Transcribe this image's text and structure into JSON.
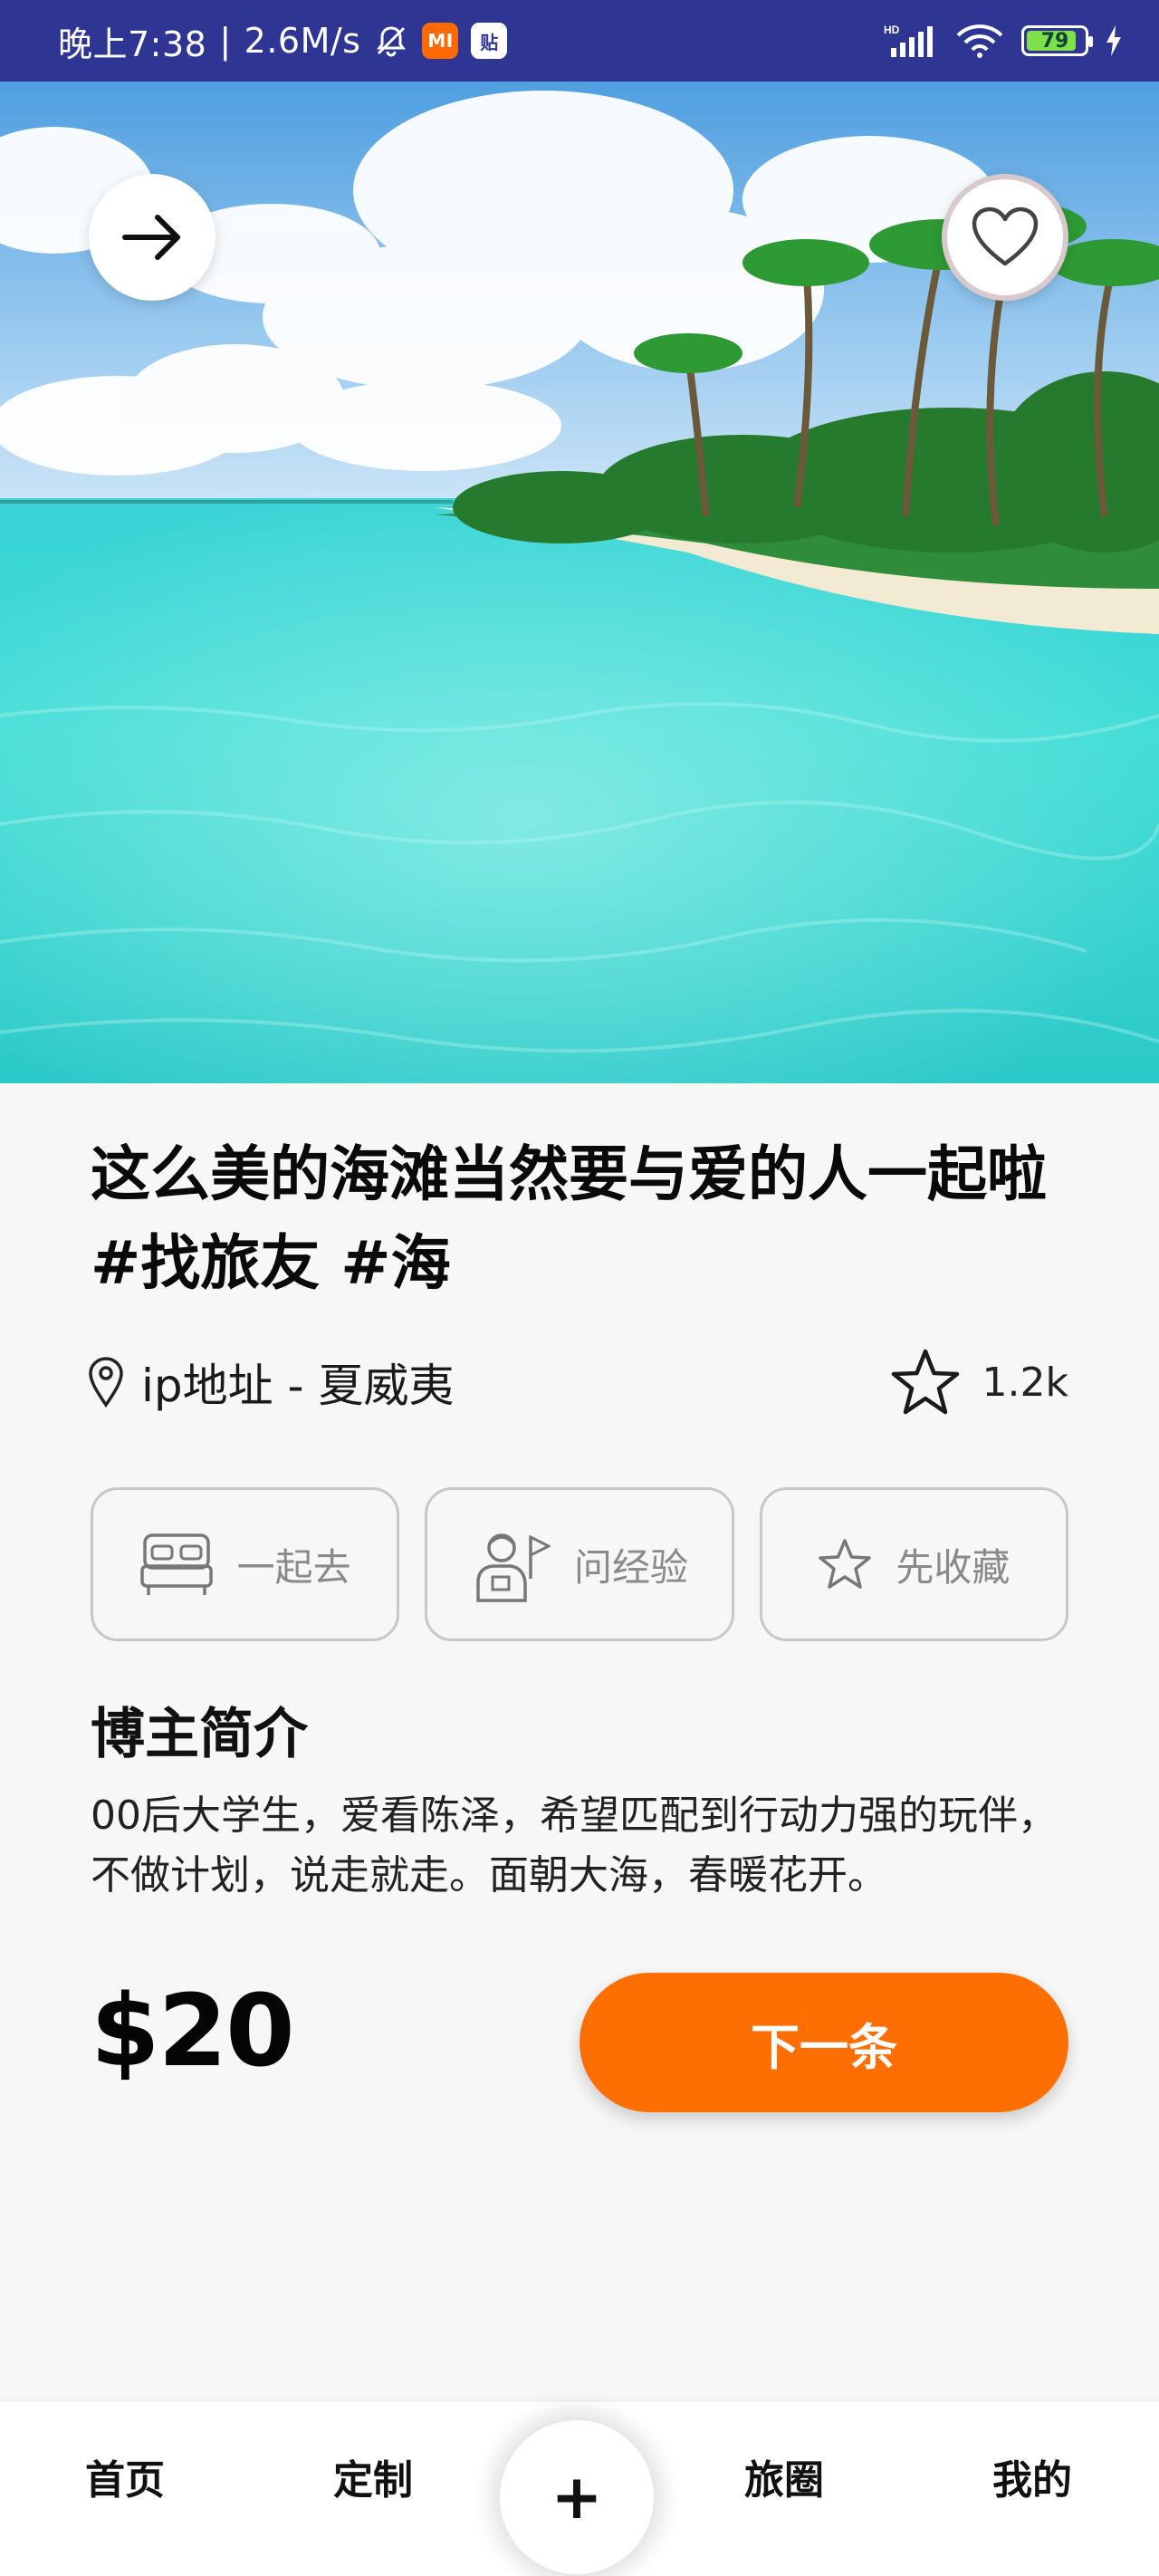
{
  "status_bar": {
    "time": "晚上7:38",
    "separator": "|",
    "speed": "2.6M/s",
    "mute_icon": "bell-off-icon",
    "app_icon_1": "MI",
    "app_icon_2": "贴",
    "network_label": "HD",
    "battery": "79",
    "battery_level": 0.79
  },
  "hero": {
    "next_icon": "arrow-right-icon",
    "like_icon": "heart-icon"
  },
  "post": {
    "title": "这么美的海滩当然要与爱的人一起啦 #找旅友 #海",
    "location": "ip地址 - 夏威夷",
    "star_count": "1.2k"
  },
  "actions": [
    {
      "label": "一起去",
      "icon": "bed-icon"
    },
    {
      "label": "问经验",
      "icon": "guide-icon"
    },
    {
      "label": "先收藏",
      "icon": "star-icon"
    }
  ],
  "blogger": {
    "section_title": "博主简介",
    "description": "00后大学生，爱看陈泽，希望匹配到行动力强的玩伴，不做计划，说走就走。面朝大海，春暖花开。"
  },
  "price": "$20",
  "next_button": "下一条",
  "bottom_nav": {
    "home": "首页",
    "custom": "定制",
    "plus": "+",
    "circle": "旅圈",
    "mine": "我的"
  },
  "colors": {
    "status_bar": "#2f3592",
    "accent": "#ff6e00",
    "background": "#f7f7f7"
  }
}
